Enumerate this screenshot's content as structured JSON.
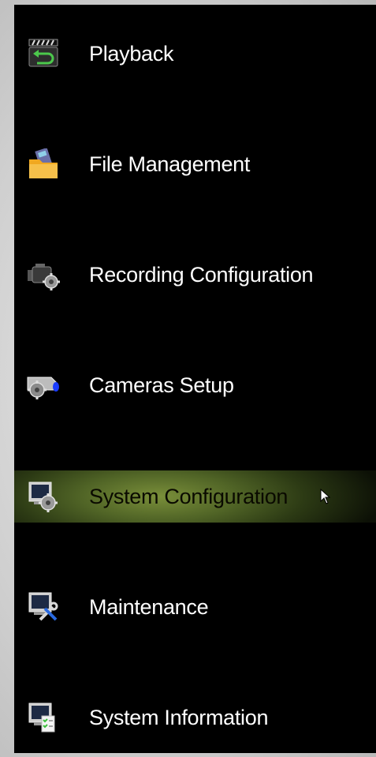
{
  "menu": {
    "items": [
      {
        "label": "Playback",
        "icon": "playback-icon"
      },
      {
        "label": "File Management",
        "icon": "folder-icon"
      },
      {
        "label": "Recording Configuration",
        "icon": "camcorder-gear-icon"
      },
      {
        "label": "Cameras Setup",
        "icon": "camera-gear-icon"
      },
      {
        "label": "System Configuration",
        "icon": "monitor-gear-icon",
        "selected": true
      },
      {
        "label": "Maintenance",
        "icon": "monitor-wrench-icon"
      },
      {
        "label": "System Information",
        "icon": "monitor-checklist-icon"
      }
    ],
    "highlight_color": "#506426"
  }
}
